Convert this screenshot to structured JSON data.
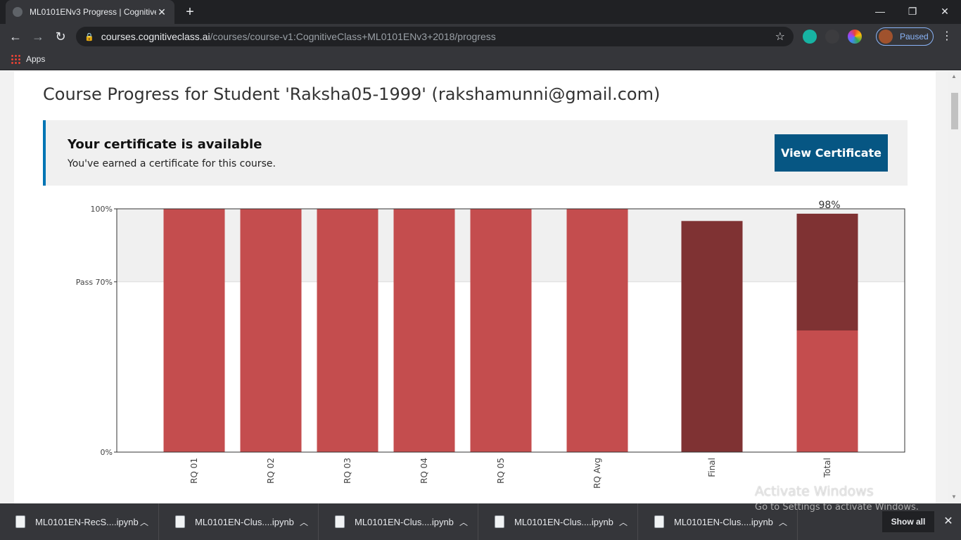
{
  "browser": {
    "tab_title": "ML0101ENv3 Progress | Cognitive",
    "url_host": "courses.cognitiveclass.ai",
    "url_path": "/courses/course-v1:CognitiveClass+ML0101ENv3+2018/progress",
    "profile_status": "Paused",
    "bookmark_apps": "Apps"
  },
  "page": {
    "title": "Course Progress for Student 'Raksha05-1999' (rakshamunni@gmail.com)",
    "certificate": {
      "heading": "Your certificate is available",
      "subtext": "You've earned a certificate for this course.",
      "button_label": "View Certificate"
    }
  },
  "chart_data": {
    "type": "bar",
    "categories": [
      "RQ 01",
      "RQ 02",
      "RQ 03",
      "RQ 04",
      "RQ 05",
      "RQ Avg",
      "Final",
      "Total"
    ],
    "values": [
      100,
      100,
      100,
      100,
      100,
      100,
      95,
      98
    ],
    "stacked_total": {
      "category": "Total",
      "lower": 50,
      "upper": 48
    },
    "y_ticks": [
      "0%",
      "Pass 70%",
      "100%"
    ],
    "ylim": [
      0,
      100
    ],
    "pass_line": 70,
    "total_label": "98%",
    "colors": {
      "rq": "#c44d4e",
      "final": "#7f3233",
      "pass_band": "#f0f0f0"
    }
  },
  "downloads": {
    "items": [
      {
        "label": "ML0101EN-RecS....ipynb"
      },
      {
        "label": "ML0101EN-Clus....ipynb"
      },
      {
        "label": "ML0101EN-Clus....ipynb"
      },
      {
        "label": "ML0101EN-Clus....ipynb"
      },
      {
        "label": "ML0101EN-Clus....ipynb"
      }
    ],
    "show_all": "Show all"
  },
  "watermark": {
    "line1": "Activate Windows",
    "line2": "Go to Settings to activate Windows."
  }
}
